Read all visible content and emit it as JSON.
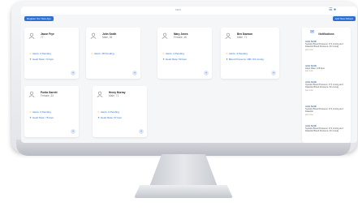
{
  "app": {
    "title": "MMS",
    "add_button_label": "Register Our New App",
    "new_patient_button_label": "Add New Patient"
  },
  "patients": [
    {
      "name": "Jason Frye",
      "age": "77",
      "alerts_label": "Alerts: 0 Pending",
      "vitals_label": "Heart Rate: 74 bpm"
    },
    {
      "name": "John Smith",
      "age": "Male, 38",
      "alerts_label": "Alerts: 28 Pending",
      "vitals_label": ""
    },
    {
      "name": "Mary Jones",
      "age": "Female, 46",
      "alerts_label": "Alerts: 2 Pending",
      "vitals_label": "Heart Rate: 60 bpm"
    },
    {
      "name": "Ben Dawson",
      "age": "Male, 71",
      "alerts_label": "Alerts: 3 Pending",
      "vitals_label": "Blood Pressure: 186 / 63 mmHg"
    },
    {
      "name": "Portia Garrett",
      "age": "Female, 33",
      "alerts_label": "Alerts: 0 Pending",
      "vitals_label": "Heart Rate: 75 bpm"
    },
    {
      "name": "Henry Murray",
      "age": "Male, 71",
      "alerts_label": "Alerts: 0 Pending",
      "vitals_label": "Heart Rate: 67 bpm"
    }
  ],
  "notifications": {
    "title": "Notifications",
    "items": [
      {
        "who": "John Smith",
        "text": "Systolic Blood Pressure: 171 mmHg and Diastolic Blood Pressure: 63 mmHg",
        "time": "just now"
      },
      {
        "who": "John Smith",
        "text": "Heart Rate: 128 bpm",
        "time": "just now"
      },
      {
        "who": "John Smith",
        "text": "Systolic Blood Pressure: 171 mmHg and Diastolic Blood Pressure: 63 mmHg",
        "time": "just now"
      },
      {
        "who": "John Smith",
        "text": "Systolic Blood Pressure: 171 mmHg and Diastolic",
        "time": "just now"
      },
      {
        "who": "John Smith",
        "text": "Systolic Blood Pressure: 171 mmHg and Diastolic Blood Pressure: 63 mmHg",
        "time": "just now"
      }
    ]
  },
  "colors": {
    "accent": "#2f6fd1",
    "warning": "#e0a100"
  }
}
